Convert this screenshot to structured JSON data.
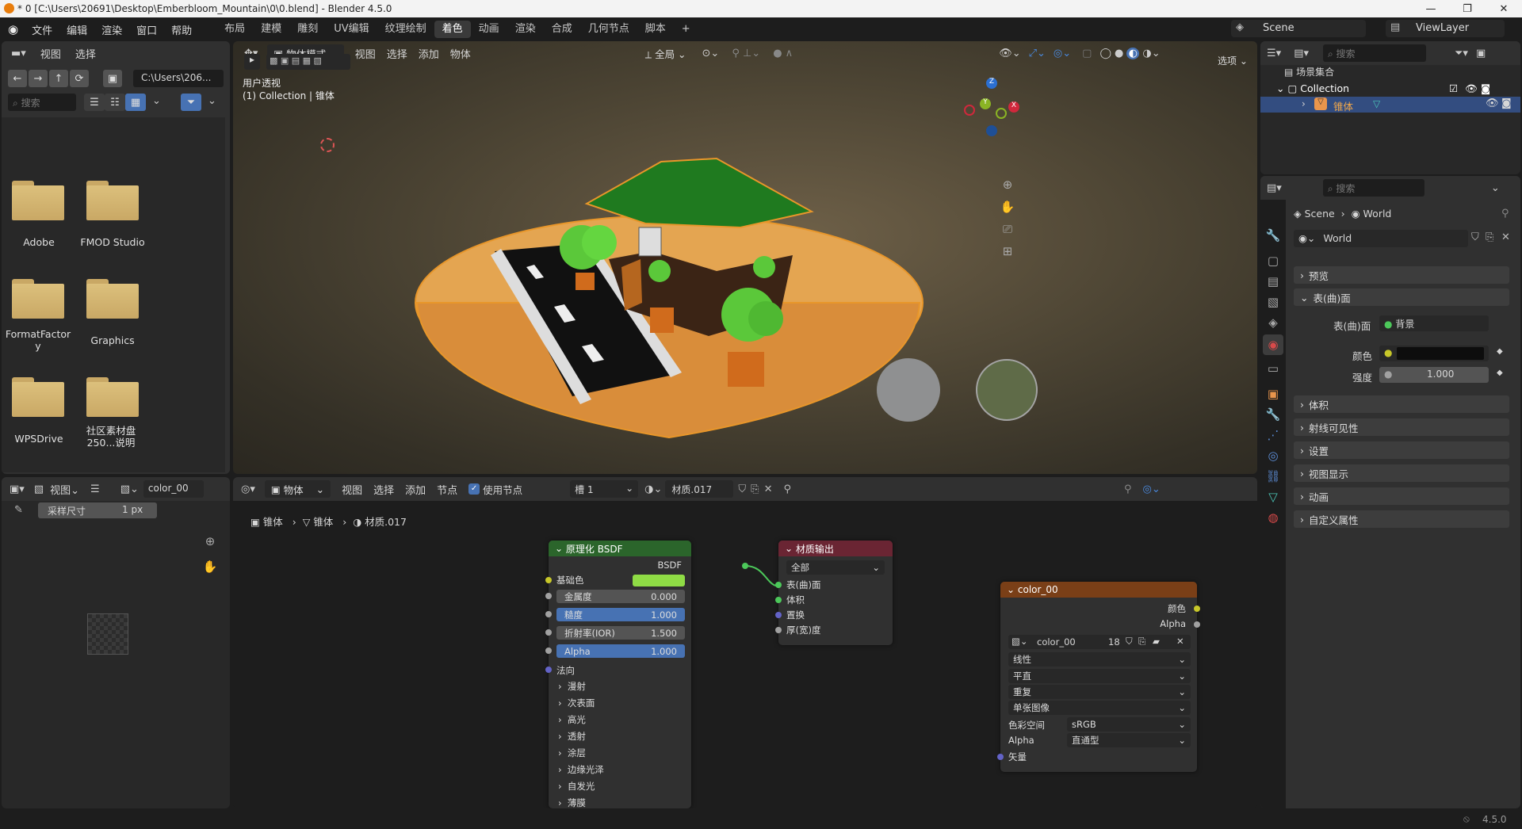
{
  "titlebar": {
    "title": "* 0 [C:\\Users\\20691\\Desktop\\Emberbloom_Mountain\\0\\0.blend] - Blender 4.5.0",
    "minimize": "—",
    "maximize": "❐",
    "close": "✕"
  },
  "menu": {
    "items": [
      "文件",
      "编辑",
      "渲染",
      "窗口",
      "帮助"
    ],
    "workspaces": [
      "布局",
      "建模",
      "雕刻",
      "UV编辑",
      "纹理绘制",
      "着色",
      "动画",
      "渲染",
      "合成",
      "几何节点",
      "脚本"
    ],
    "active_workspace": "着色",
    "add": "+",
    "scene": "Scene",
    "viewlayer": "ViewLayer"
  },
  "filebrowser": {
    "menu_view": "视图",
    "menu_select": "选择",
    "path": "C:\\Users\\206...",
    "search_placeholder": "搜索",
    "folders": [
      "Adobe",
      "FMOD Studio",
      "FormatFactory",
      "Graphics",
      "WPSDrive",
      "社区素材盘250...说明"
    ]
  },
  "viewport": {
    "mode": "物体模式",
    "menus": [
      "视图",
      "选择",
      "添加",
      "物体"
    ],
    "transform": "全局",
    "options": "选项",
    "view_name": "用户透视",
    "collection_info": "(1) Collection | 锥体",
    "gizmo": {
      "x": "X",
      "y": "Y",
      "z": "Z"
    }
  },
  "outliner": {
    "search_placeholder": "搜索",
    "scene_collection": "场景集合",
    "collection": "Collection",
    "object": "锥体"
  },
  "properties": {
    "search_placeholder": "搜索",
    "breadcrumb_scene": "Scene",
    "breadcrumb_world": "World",
    "world_name": "World",
    "sections": {
      "preview": "预览",
      "surface": "表(曲)面",
      "volume": "体积",
      "ray_visibility": "射线可见性",
      "settings": "设置",
      "viewport_display": "视图显示",
      "animation": "动画",
      "custom_props": "自定义属性"
    },
    "surface_label": "表(曲)面",
    "surface_value": "背景",
    "color_label": "颜色",
    "strength_label": "强度",
    "strength_value": "1.000",
    "world_color": "#0d0d0d"
  },
  "image_editor": {
    "view": "视图",
    "image": "color_00",
    "sample_label": "采样尺寸",
    "sample_value": "1 px"
  },
  "node_editor": {
    "menu_object": "物体",
    "menus": [
      "视图",
      "选择",
      "添加",
      "节点"
    ],
    "use_nodes": "使用节点",
    "slot": "槽 1",
    "material": "材质.017",
    "breadcrumb": [
      "锥体",
      "锥体",
      "材质.017"
    ],
    "bsdf": {
      "title": "原理化 BSDF",
      "out": "BSDF",
      "base_color": "基础色",
      "base_color_hex": "#8fdc45",
      "metallic": "金属度",
      "metallic_value": "0.000",
      "roughness": "糙度",
      "roughness_value": "1.000",
      "ior": "折射率(IOR)",
      "ior_value": "1.500",
      "alpha": "Alpha",
      "alpha_value": "1.000",
      "normal": "法向",
      "panels": [
        "漫射",
        "次表面",
        "高光",
        "透射",
        "涂层",
        "边缘光泽",
        "自发光",
        "薄膜"
      ]
    },
    "output": {
      "title": "材质输出",
      "target": "全部",
      "surface": "表(曲)面",
      "volume": "体积",
      "displacement": "置换",
      "thickness": "厚(宽)度"
    },
    "image_node": {
      "title": "color_00",
      "color": "颜色",
      "alpha": "Alpha",
      "image": "color_00",
      "users": "18",
      "interp": "线性",
      "proj": "平直",
      "ext": "重复",
      "source": "单张图像",
      "colorspace_label": "色彩空间",
      "colorspace": "sRGB",
      "alpha_label": "Alpha",
      "alpha_mode": "直通型",
      "vector": "矢量"
    }
  },
  "statusbar": {
    "version": "4.5.0"
  }
}
